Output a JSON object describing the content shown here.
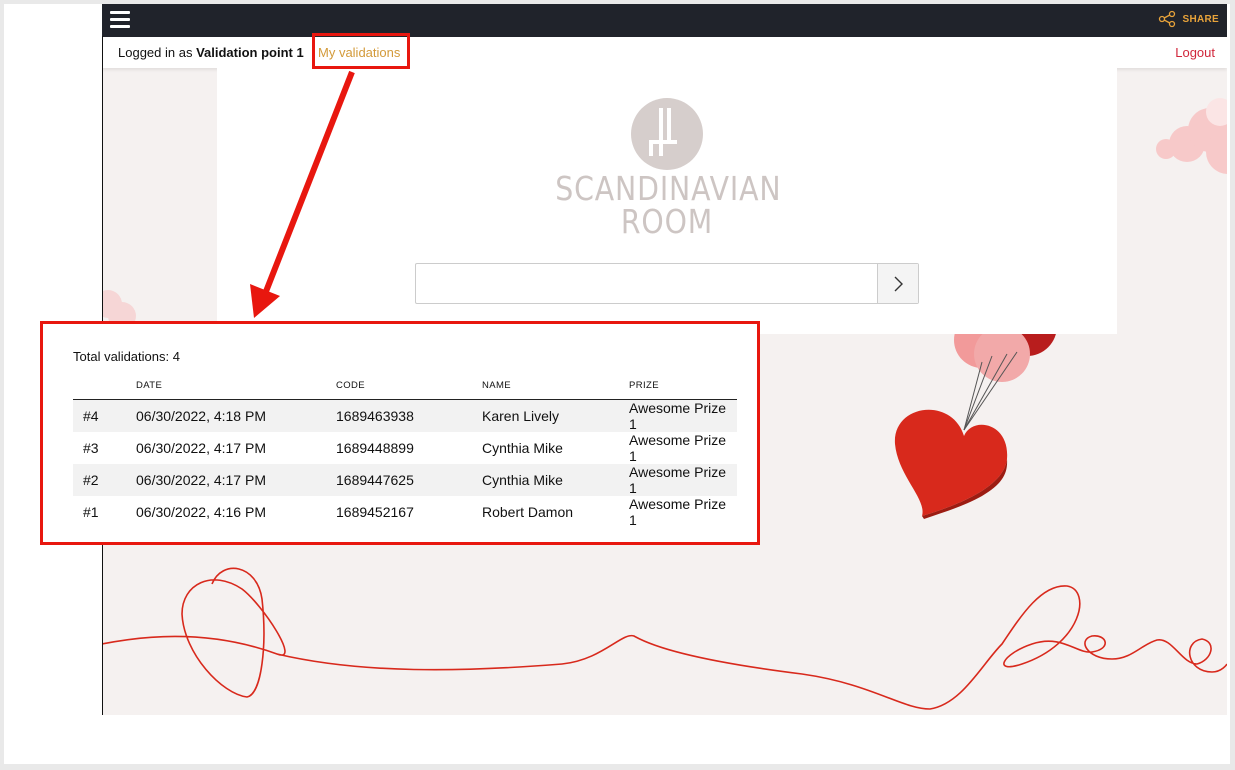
{
  "header": {
    "share_label": "SHARE",
    "share_icon": "share-icon",
    "menu_icon": "hamburger-menu-icon"
  },
  "subbar": {
    "logged_in_prefix": "Logged in as",
    "user_name": "Validation point 1",
    "my_validations_label": "My validations",
    "logout_label": "Logout"
  },
  "brand": {
    "logo_line1": "SCANDINAVIAN",
    "logo_line2": "ROOM"
  },
  "search": {
    "placeholder": "",
    "value": "",
    "submit_icon": "chevron-right-icon"
  },
  "validations": {
    "total_label": "Total validations: 4",
    "columns": [
      "",
      "DATE",
      "CODE",
      "NAME",
      "PRIZE"
    ],
    "rows": [
      {
        "index": "#4",
        "date": "06/30/2022, 4:18 PM",
        "code": "1689463938",
        "name": "Karen Lively",
        "prize": "Awesome Prize 1"
      },
      {
        "index": "#3",
        "date": "06/30/2022, 4:17 PM",
        "code": "1689448899",
        "name": "Cynthia Mike",
        "prize": "Awesome Prize 1"
      },
      {
        "index": "#2",
        "date": "06/30/2022, 4:17 PM",
        "code": "1689447625",
        "name": "Cynthia Mike",
        "prize": "Awesome Prize 1"
      },
      {
        "index": "#1",
        "date": "06/30/2022, 4:16 PM",
        "code": "1689452167",
        "name": "Robert Damon",
        "prize": "Awesome Prize 1"
      }
    ]
  },
  "colors": {
    "annotation_red": "#e8170f",
    "accent_orange": "#d39a3a",
    "logout_red": "#d0263a",
    "topbar": "#20232b",
    "heart_red": "#d8291c"
  }
}
